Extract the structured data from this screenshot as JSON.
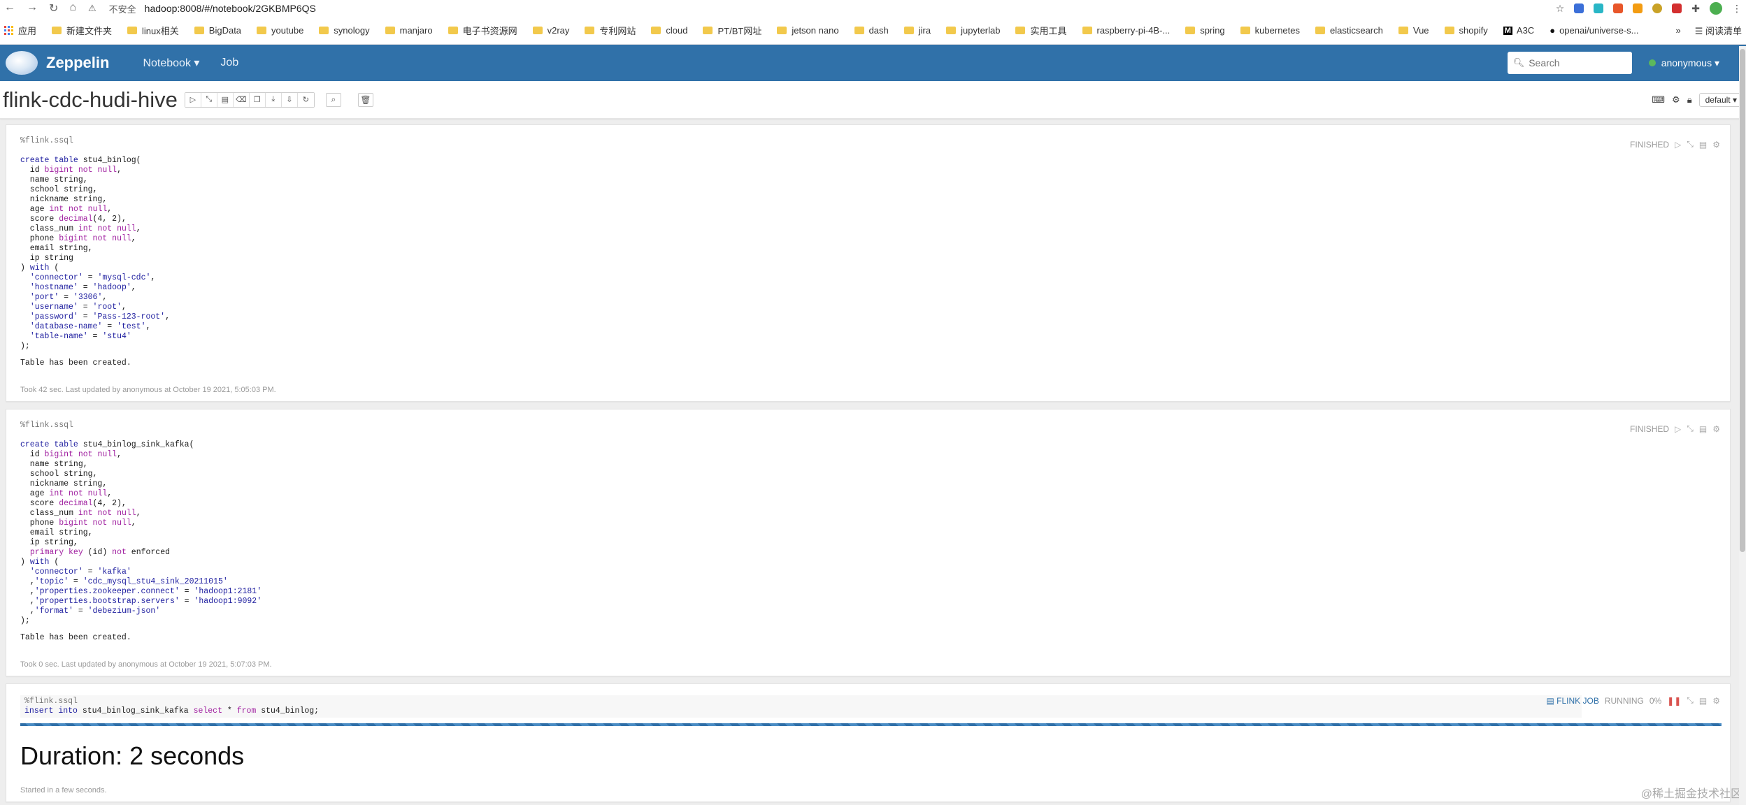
{
  "browser": {
    "insecure_label": "不安全",
    "url": "hadoop:8008/#/notebook/2GKBMP6QS",
    "reading_list": "阅读清单",
    "more_bookmarks": "»"
  },
  "bookmarks": [
    {
      "label": "应用",
      "icon": "apps-icon"
    },
    {
      "label": "新建文件夹",
      "icon": "folder-icon"
    },
    {
      "label": "linux相关",
      "icon": "folder-icon"
    },
    {
      "label": "BigData",
      "icon": "folder-icon"
    },
    {
      "label": "youtube",
      "icon": "folder-icon"
    },
    {
      "label": "synology",
      "icon": "folder-icon"
    },
    {
      "label": "manjaro",
      "icon": "folder-icon"
    },
    {
      "label": "电子书资源网",
      "icon": "folder-icon"
    },
    {
      "label": "v2ray",
      "icon": "folder-icon"
    },
    {
      "label": "专利网站",
      "icon": "folder-icon"
    },
    {
      "label": "cloud",
      "icon": "folder-icon"
    },
    {
      "label": "PT/BT网址",
      "icon": "folder-icon"
    },
    {
      "label": "jetson nano",
      "icon": "folder-icon"
    },
    {
      "label": "dash",
      "icon": "folder-icon"
    },
    {
      "label": "jira",
      "icon": "folder-icon"
    },
    {
      "label": "jupyterlab",
      "icon": "folder-icon"
    },
    {
      "label": "实用工具",
      "icon": "folder-icon"
    },
    {
      "label": "raspberry-pi-4B-...",
      "icon": "folder-icon"
    },
    {
      "label": "spring",
      "icon": "folder-icon"
    },
    {
      "label": "kubernetes",
      "icon": "folder-icon"
    },
    {
      "label": "elasticsearch",
      "icon": "folder-icon"
    },
    {
      "label": "Vue",
      "icon": "folder-icon"
    },
    {
      "label": "shopify",
      "icon": "folder-icon"
    },
    {
      "label": "A3C",
      "icon": "medium-icon"
    },
    {
      "label": "openai/universe-s...",
      "icon": "github-icon"
    }
  ],
  "navbar": {
    "brand": "Zeppelin",
    "menu_notebook": "Notebook ▾",
    "menu_job": "Job",
    "search_placeholder": "Search",
    "user": "anonymous ▾"
  },
  "notebook": {
    "title": "flink-cdc-hudi-hive",
    "interpreter_default": "default ▾"
  },
  "paragraphs": [
    {
      "status": "FINISHED",
      "code": [
        "%flink.ssql",
        "",
        "create table stu4_binlog(",
        "  id bigint not null,",
        "  name string,",
        "  school string,",
        "  nickname string,",
        "  age int not null,",
        "  score decimal(4, 2),",
        "  class_num int not null,",
        "  phone bigint not null,",
        "  email string,",
        "  ip string",
        ") with (",
        "  'connector' = 'mysql-cdc',",
        "  'hostname' = 'hadoop',",
        "  'port' = '3306',",
        "  'username' = 'root',",
        "  'password' = 'Pass-123-root',",
        "  'database-name' = 'test',",
        "  'table-name' = 'stu4'",
        ");"
      ],
      "result": "Table has been created.",
      "footer": "Took 42 sec. Last updated by anonymous at October 19 2021, 5:05:03 PM."
    },
    {
      "status": "FINISHED",
      "code": [
        "%flink.ssql",
        "",
        "create table stu4_binlog_sink_kafka(",
        "  id bigint not null,",
        "  name string,",
        "  school string,",
        "  nickname string,",
        "  age int not null,",
        "  score decimal(4, 2),",
        "  class_num int not null,",
        "  phone bigint not null,",
        "  email string,",
        "  ip string,",
        "  primary key (id) not enforced",
        ") with (",
        "  'connector' = 'kafka'",
        "  ,'topic' = 'cdc_mysql_stu4_sink_20211015'",
        "  ,'properties.zookeeper.connect' = 'hadoop1:2181'",
        "  ,'properties.bootstrap.servers' = 'hadoop1:9092'",
        "  ,'format' = 'debezium-json'",
        ");"
      ],
      "result": "Table has been created.",
      "footer": "Took 0 sec. Last updated by anonymous at October 19 2021, 5:07:03 PM."
    },
    {
      "status": "RUNNING",
      "flink_job_label": "FLINK JOB",
      "progress": "0%",
      "code": [
        "%flink.ssql",
        "insert into stu4_binlog_sink_kafka select * from stu4_binlog;"
      ],
      "duration": "Duration: 2 seconds",
      "footer": "Started in a few seconds."
    }
  ],
  "watermark": "@稀土掘金技术社区",
  "colors": {
    "navbar": "#3071a9",
    "keyword": "#a020a0",
    "string": "#2020a0"
  }
}
